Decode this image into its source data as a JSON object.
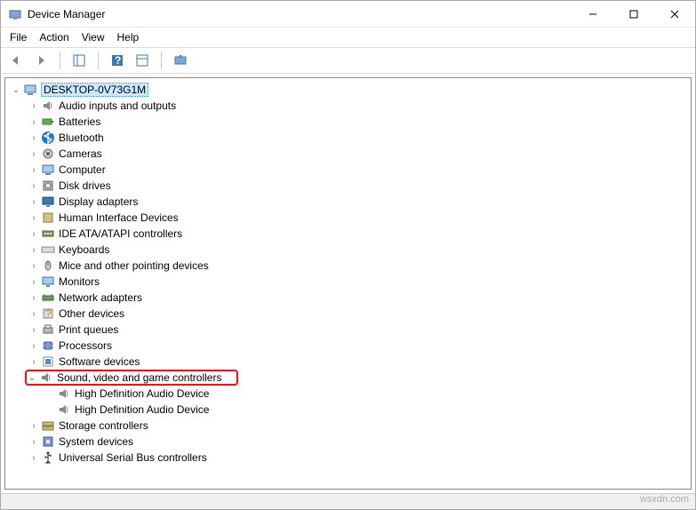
{
  "window": {
    "title": "Device Manager"
  },
  "menu": {
    "file": "File",
    "action": "Action",
    "view": "View",
    "help": "Help"
  },
  "root": {
    "name": "DESKTOP-0V73G1M"
  },
  "watermark": "wsxdn.com",
  "categories": [
    {
      "name": "Audio inputs and outputs",
      "icon": "speaker"
    },
    {
      "name": "Batteries",
      "icon": "battery"
    },
    {
      "name": "Bluetooth",
      "icon": "bluetooth"
    },
    {
      "name": "Cameras",
      "icon": "camera"
    },
    {
      "name": "Computer",
      "icon": "computer"
    },
    {
      "name": "Disk drives",
      "icon": "disk"
    },
    {
      "name": "Display adapters",
      "icon": "display"
    },
    {
      "name": "Human Interface Devices",
      "icon": "hid"
    },
    {
      "name": "IDE ATA/ATAPI controllers",
      "icon": "ide"
    },
    {
      "name": "Keyboards",
      "icon": "keyboard"
    },
    {
      "name": "Mice and other pointing devices",
      "icon": "mouse"
    },
    {
      "name": "Monitors",
      "icon": "monitor"
    },
    {
      "name": "Network adapters",
      "icon": "network"
    },
    {
      "name": "Other devices",
      "icon": "other"
    },
    {
      "name": "Print queues",
      "icon": "printer"
    },
    {
      "name": "Processors",
      "icon": "cpu"
    },
    {
      "name": "Software devices",
      "icon": "software"
    },
    {
      "name": "Sound, video and game controllers",
      "icon": "speaker",
      "highlight": true,
      "expanded": true,
      "children": [
        {
          "name": "High Definition Audio Device",
          "icon": "speaker"
        },
        {
          "name": "High Definition Audio Device",
          "icon": "speaker"
        }
      ]
    },
    {
      "name": "Storage controllers",
      "icon": "storage"
    },
    {
      "name": "System devices",
      "icon": "system"
    },
    {
      "name": "Universal Serial Bus controllers",
      "icon": "usb"
    }
  ]
}
